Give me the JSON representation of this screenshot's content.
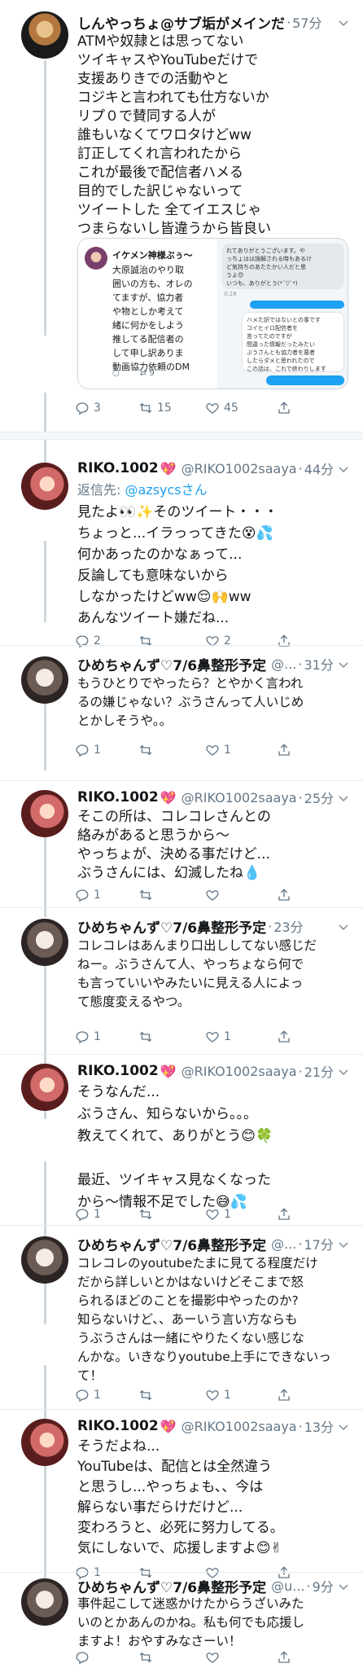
{
  "tweets": [
    {
      "name": "しんやっちょ@サブ垢がメインだ",
      "time": "57分",
      "body": "ATMや奴隷とは思ってない\nツイキャスやYouTubeだけで\n支援ありきでの活動やと\nコジキと言われても仕方ないか\nリプ０で賛同する人が\n誰もいなくてワロタけどww\n訂正してくれ言われたから\nこれが最後で配信者ハメる\n目的でした訳じゃないって\nツイートした 全てイエスじゃ\nつまらないし皆違うから皆良い",
      "media": {
        "quoted_name": "イケメン神様ぶぅ〜",
        "quoted_text": "大原誠治のやり取\n囲いの方も、オレの\nてますが、協力者\nや物としか考えて\n緒に何かをしよう\n推してる配信者の\nして申し訳ありま\n動画協力依頼のDM",
        "quoted_retweets": "9",
        "dm_top": "れてありがとうございます。や\nっちょはは誤解される時もあるけ\nど気持ちのあたたかい人だと思\nうよ😊\nいつも、ありがとう(*´▽`*)",
        "dm_time": "0:28",
        "dm_middle": "ハメた訳ではないとの事です\nコイヒイロ配信者を\n言ってたのですが\n間違った情報だったみたい\nぶうさんとも協力者を悪者\nしたらダメと思われたので\nこの話は、これで終わりします"
      },
      "replies": "3",
      "retweets": "15",
      "likes": "45"
    },
    {
      "name": "RIKO.1002",
      "heart": "💖",
      "handle": "@RIKO1002saaya",
      "time": "44分",
      "reply_label": "返信先: ",
      "reply_mention": "@azsycsさん",
      "body": "見たよ👀✨そのツイート・・・\nちょっと...イラっってきた😵💦\n何かあったのかなぁって...\n反論しても意味ないから\nしなかったけどww😌🙌ww\nあんなツイート嫌だね...",
      "replies": "2",
      "retweets": "",
      "likes": "2"
    },
    {
      "name": "ひめちゃんず♡7/6鼻整形予定",
      "handle": "@...",
      "time": "31分",
      "body": "もうひとりでやったら？とやかく言われ\nるの嫌じゃない？ぶうさんって人いじめ\nとかしそうや。。",
      "replies": "1",
      "retweets": "",
      "likes": "1"
    },
    {
      "name": "RIKO.1002",
      "heart": "💖",
      "handle": "@RIKO1002saaya",
      "time": "25分",
      "body": "そこの所は、コレコレさんとの\n絡みがあると思うから〜\nやっちょが、決める事だけど...\nぶうさんには、幻滅したね💧",
      "replies": "1",
      "retweets": "",
      "likes": ""
    },
    {
      "name": "ひめちゃんず♡7/6鼻整形予定",
      "handle": "",
      "time": "23分",
      "body": "コレコレはあんまり口出ししてない感じだ\nねー。ぶうさんて人、やっちょなら何で\nも言っていいやみたいに見える人によっ\nて態度変えるやつ。",
      "replies": "1",
      "retweets": "",
      "likes": "1"
    },
    {
      "name": "RIKO.1002",
      "heart": "💖",
      "handle": "@RIKO1002saaya",
      "time": "21分",
      "body": "そうなんだ...\nぶうさん、知らないから。。。\n教えてくれて、ありがとう😊🍀\n\n最近、ツイキャス見なくなった\nから〜情報不足でした😅💦",
      "replies": "1",
      "retweets": "",
      "likes": "1"
    },
    {
      "name": "ひめちゃんず♡7/6鼻整形予定",
      "handle": "@...",
      "time": "17分",
      "body": "コレコレのyoutubeたまに見てる程度だけ\nだから詳しいとかはないけどそこまで怒\nられるほどのことを撮影中やったのか?\n知らないけど、、あーいう言い方ならも\nうぶうさんは一緒にやりたくない感じな\nんかな。いきなりyoutube上手にできないっ\nて！",
      "replies": "1",
      "retweets": "",
      "likes": "1"
    },
    {
      "name": "RIKO.1002",
      "heart": "💖",
      "handle": "@RIKO1002saaya",
      "time": "13分",
      "body": "そうだよね...\nYouTubeは、配信とは全然違う\nと思うし...やっちょも、、今は\n解らない事だらけだけど...\n変わろうと、必死に努力してる。\n気にしないで、応援しますよ😊✌",
      "replies": "1",
      "retweets": "",
      "likes": ""
    },
    {
      "name": "ひめちゃんず♡7/6鼻整形予定",
      "handle": "@u...",
      "time": "9分",
      "body": "事件起こして迷惑かけたからうざいみた\nいのとかあんのかね。私も何でも応援し\nますよ！おやすみなさーい！",
      "replies": "",
      "retweets": "",
      "likes": ""
    }
  ]
}
